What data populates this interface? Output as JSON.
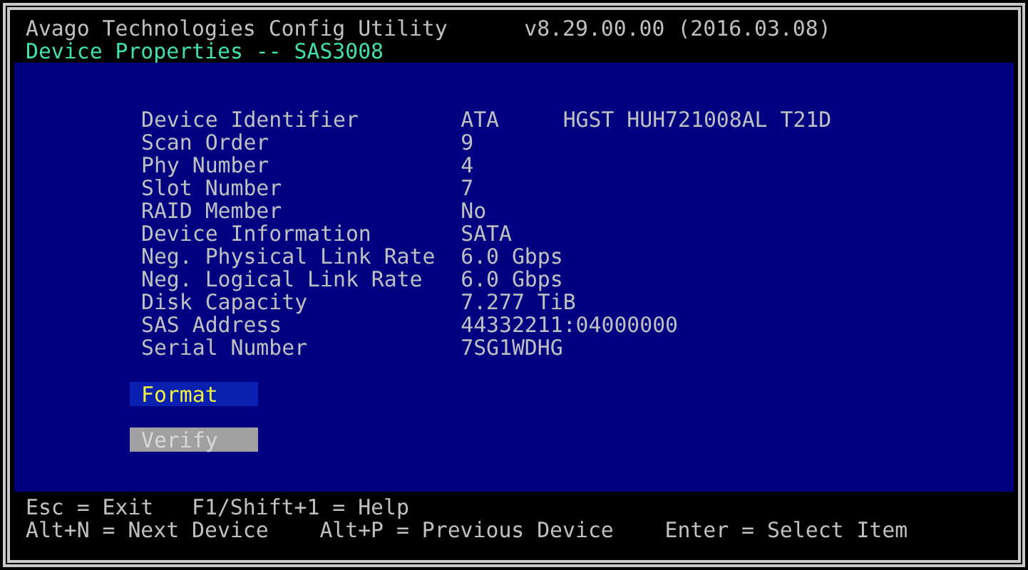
{
  "header": {
    "title": "Avago Technologies Config Utility",
    "version": "v8.29.00.00 (2016.03.08)",
    "page_title": "Device Properties -- SAS3008"
  },
  "properties": [
    {
      "label": "Device Identifier",
      "value": "ATA     HGST HUH721008AL T21D"
    },
    {
      "label": "Scan Order",
      "value": "9"
    },
    {
      "label": "Phy Number",
      "value": "4"
    },
    {
      "label": "Slot Number",
      "value": "7"
    },
    {
      "label": "RAID Member",
      "value": "No"
    },
    {
      "label": "Device Information",
      "value": "SATA"
    },
    {
      "label": "Neg. Physical Link Rate",
      "value": "6.0 Gbps"
    },
    {
      "label": "Neg. Logical Link Rate",
      "value": "6.0 Gbps"
    },
    {
      "label": "Disk Capacity",
      "value": "7.277 TiB"
    },
    {
      "label": "SAS Address",
      "value": "44332211:04000000"
    },
    {
      "label": "Serial Number",
      "value": "7SG1WDHG"
    }
  ],
  "actions": [
    {
      "label": "Format",
      "selected": true,
      "disabled": false
    },
    {
      "label": "Verify",
      "selected": false,
      "disabled": true
    }
  ],
  "footer": [
    [
      "Esc = Exit",
      "F1/Shift+1 = Help"
    ],
    [
      "Alt+N = Next Device",
      "Alt+P = Previous Device",
      "Enter = Select Item"
    ]
  ]
}
